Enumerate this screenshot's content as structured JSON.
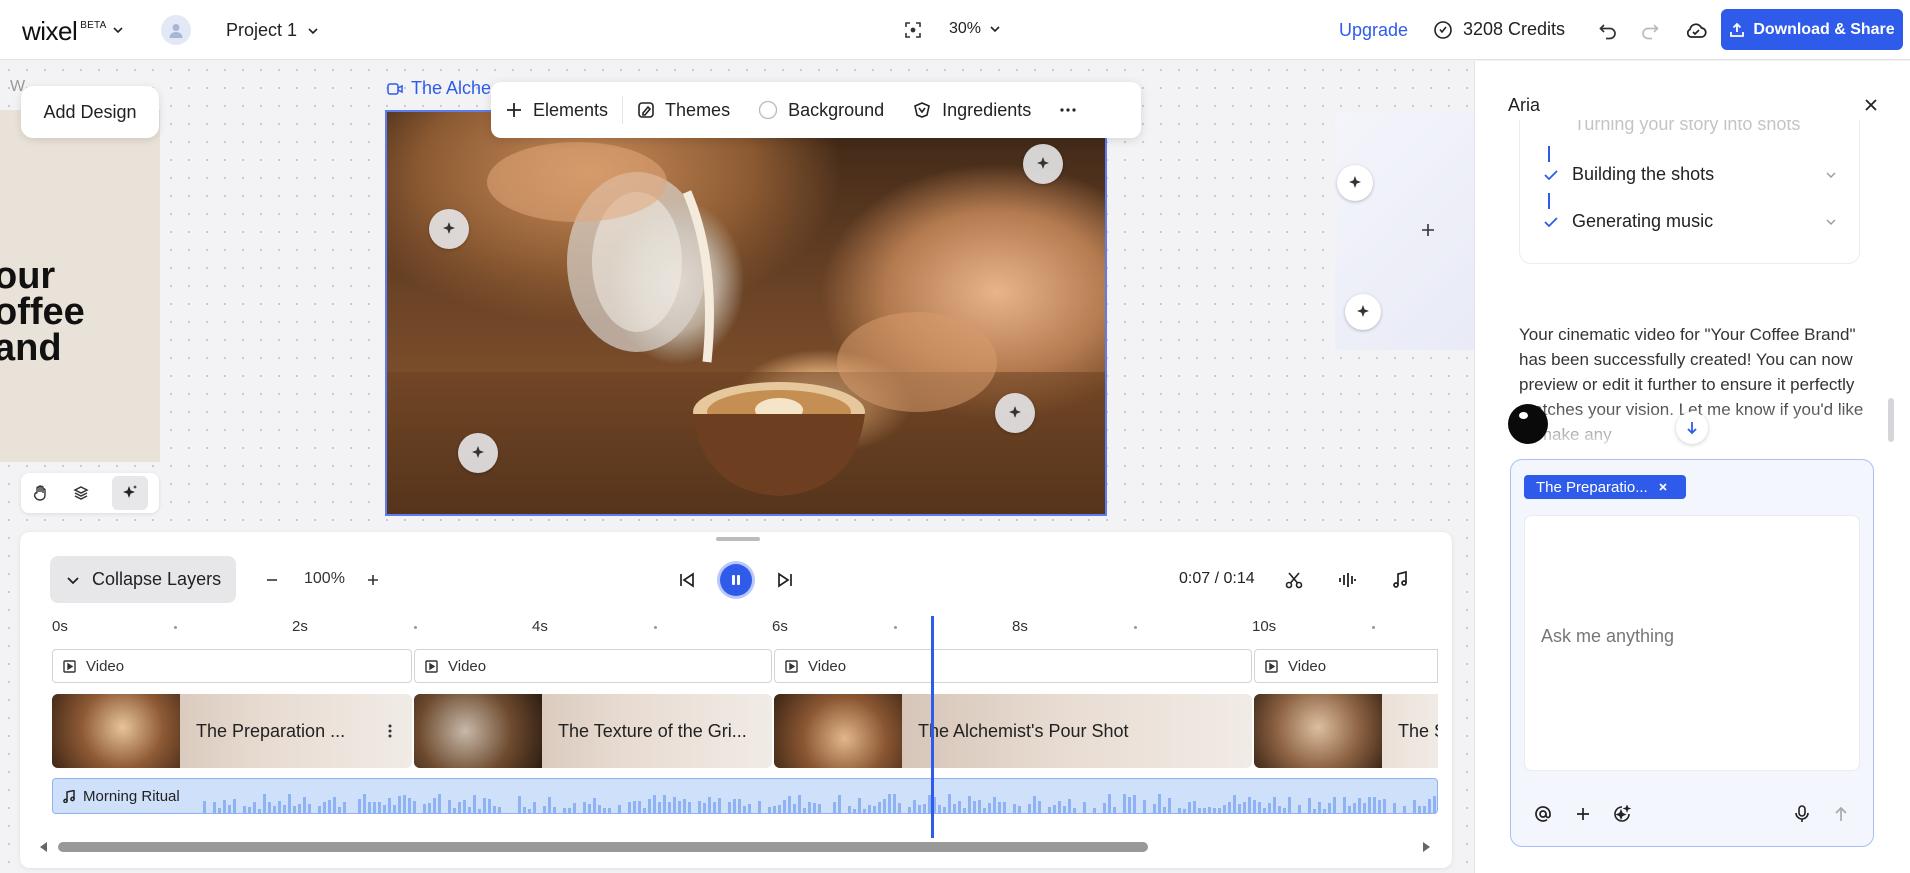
{
  "topbar": {
    "logo": "wixel",
    "logo_badge": "BETA",
    "project_name": "Project 1",
    "zoom": "30%",
    "upgrade_label": "Upgrade",
    "credits": "3208 Credits",
    "download_label": "Download & Share"
  },
  "canvas": {
    "left_frame_label": "W...",
    "add_design_label": "Add Design",
    "left_frame_text": [
      "our",
      "offee",
      "and"
    ],
    "frame_title": "The Alche",
    "toolbar": {
      "elements": "Elements",
      "themes": "Themes",
      "background": "Background",
      "ingredients": "Ingredients"
    }
  },
  "timeline": {
    "collapse_label": "Collapse Layers",
    "zoom": "100%",
    "time": "0:07 / 0:14",
    "ruler": [
      "0s",
      "2s",
      "4s",
      "6s",
      "8s",
      "10s"
    ],
    "video_label": "Video",
    "clips": [
      "The Preparation ...",
      "The Texture of the Gri...",
      "The Alchemist's Pour Shot",
      "The S"
    ],
    "audio_label": "Morning Ritual",
    "playhead_seconds": 7.0
  },
  "aria": {
    "title": "Aria",
    "steps_cut": "Turning your story into shots",
    "steps": [
      "Building the shots",
      "Generating music"
    ],
    "message": "Your cinematic video for \"Your Coffee Brand\" has been successfully created! You can now preview or edit it further to ensure it perfectly matches your vision. Let me know if you'd like to make any",
    "chip_label": "The Preparatio...",
    "input_placeholder": "Ask me anything"
  },
  "colors": {
    "accent": "#2f5bea",
    "playhead": "#2f5bea",
    "audio_track": "#cfe0fb"
  }
}
